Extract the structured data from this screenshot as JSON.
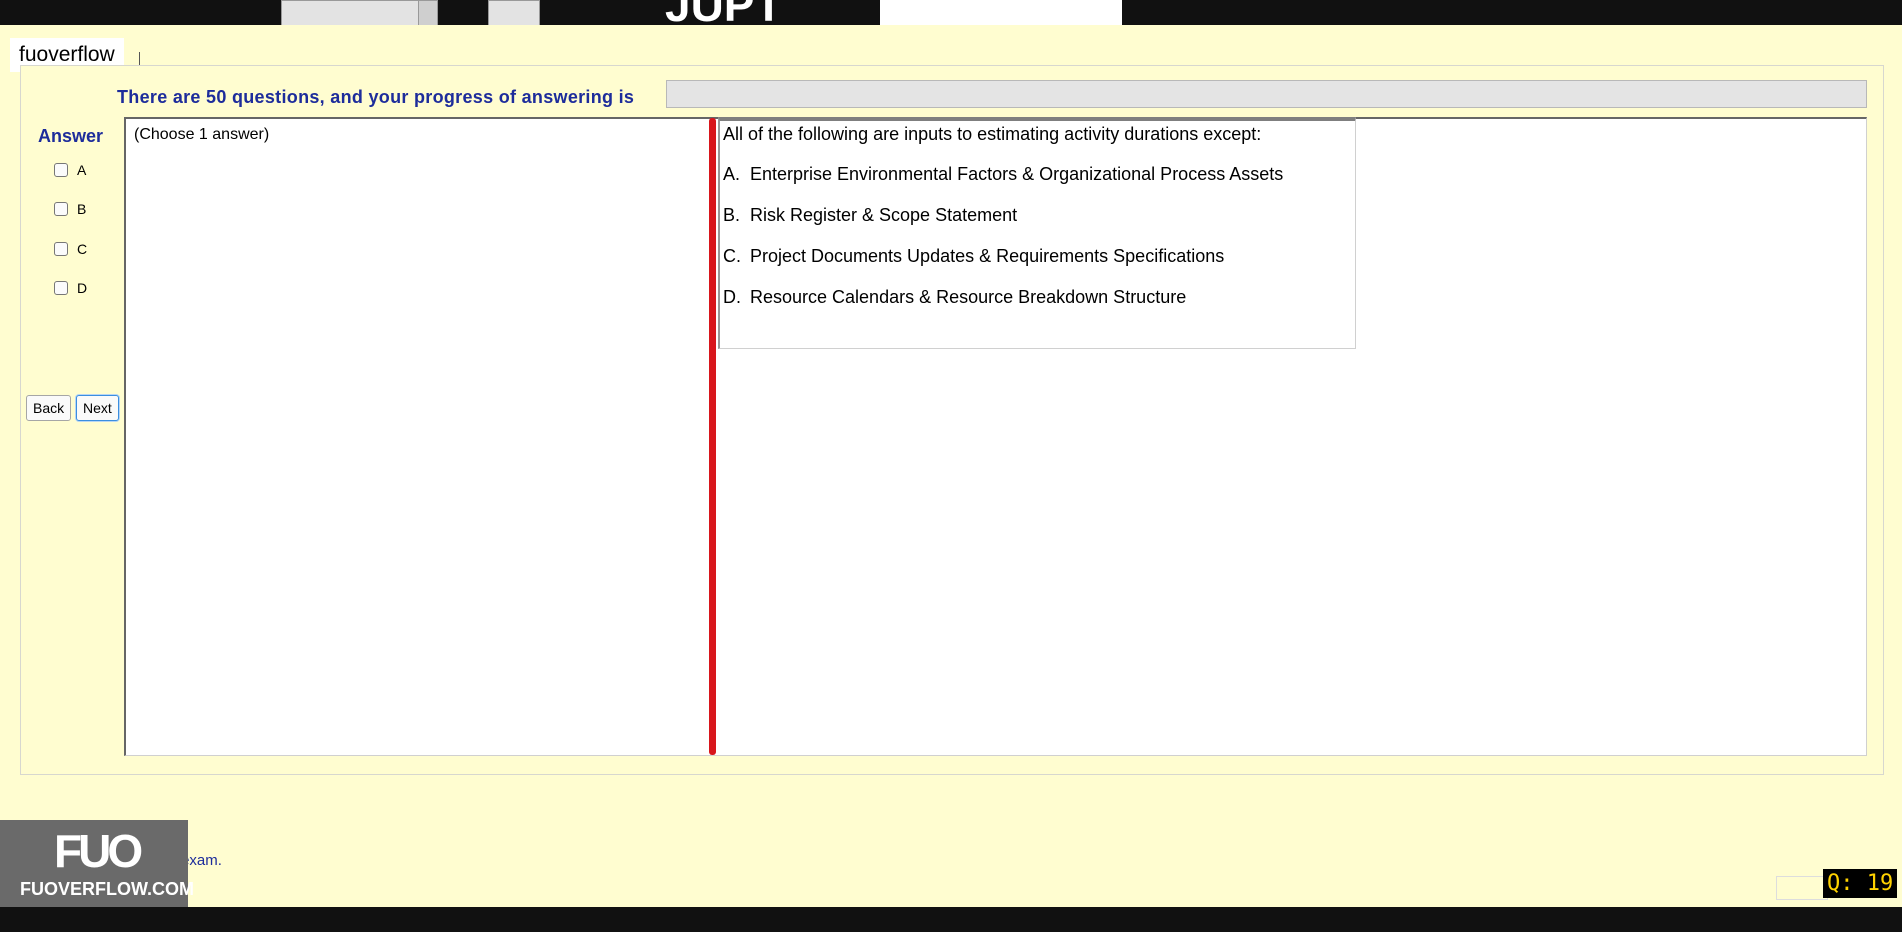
{
  "header": {
    "partial_title": "JUPT"
  },
  "tag_label": "fuoverflow",
  "progress": {
    "label": "There are 50 questions, and your progress of answering is",
    "fraction": 0
  },
  "answer": {
    "title": "Answer",
    "options": [
      "A",
      "B",
      "C",
      "D"
    ]
  },
  "nav": {
    "back": "Back",
    "next": "Next"
  },
  "question": {
    "instruction": "(Choose 1 answer)",
    "text": "All of the following are inputs to estimating activity durations except:",
    "choices": [
      {
        "letter": "A.",
        "text": "Enterprise Environmental Factors & Organizational Process Assets"
      },
      {
        "letter": "B.",
        "text": "Risk Register & Scope Statement"
      },
      {
        "letter": "C.",
        "text": "Project Documents Updates & Requirements Specifications"
      },
      {
        "letter": "D.",
        "text": "Resource Calendars & Resource Breakdown Structure"
      }
    ]
  },
  "footer": {
    "finish_label": "I want to finish the exam.",
    "logo_text": "FUO",
    "logo_url": "FUOVERFLOW.COM",
    "question_counter": "Q: 19"
  },
  "colors": {
    "background": "#fffdd0",
    "accent_blue": "#1d2c9b",
    "splitter_red": "#d8161c",
    "counter_yellow": "#ffd200"
  }
}
